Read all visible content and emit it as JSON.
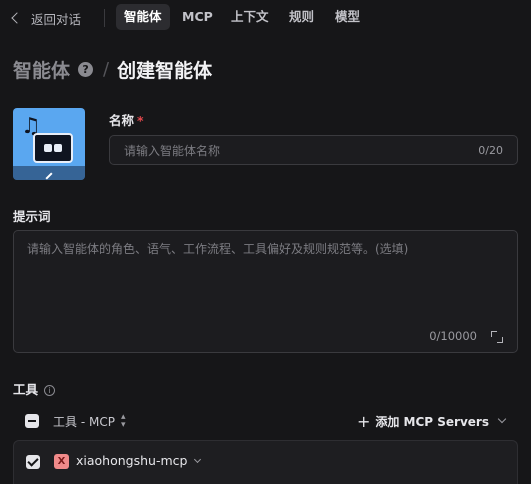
{
  "topbar": {
    "back_label": "返回对话",
    "tabs": [
      {
        "label": "智能体",
        "active": true
      },
      {
        "label": "MCP",
        "active": false
      },
      {
        "label": "上下文",
        "active": false
      },
      {
        "label": "规则",
        "active": false
      },
      {
        "label": "模型",
        "active": false
      }
    ]
  },
  "header": {
    "breadcrumb": "智能体",
    "help_glyph": "?",
    "separator": "/",
    "title": "创建智能体"
  },
  "form": {
    "name_label": "名称",
    "required_mark": "*",
    "name_placeholder": "请输入智能体名称",
    "name_counter": "0/20",
    "prompt_label": "提示词",
    "prompt_placeholder": "请输入智能体的角色、语气、工作流程、工具偏好及规则规范等。(选填)",
    "prompt_counter": "0/10000"
  },
  "tools": {
    "label": "工具",
    "info_glyph": "i",
    "column_label": "工具 - MCP",
    "add_label": "添加 MCP Servers",
    "plus_glyph": "+",
    "items": [
      {
        "badge": "X",
        "name": "xiaohongshu-mcp",
        "checked": true
      }
    ]
  },
  "colors": {
    "background": "#161618",
    "avatar": "#5aa7f0",
    "required": "#e5484d",
    "badge": "#f08a8a"
  }
}
